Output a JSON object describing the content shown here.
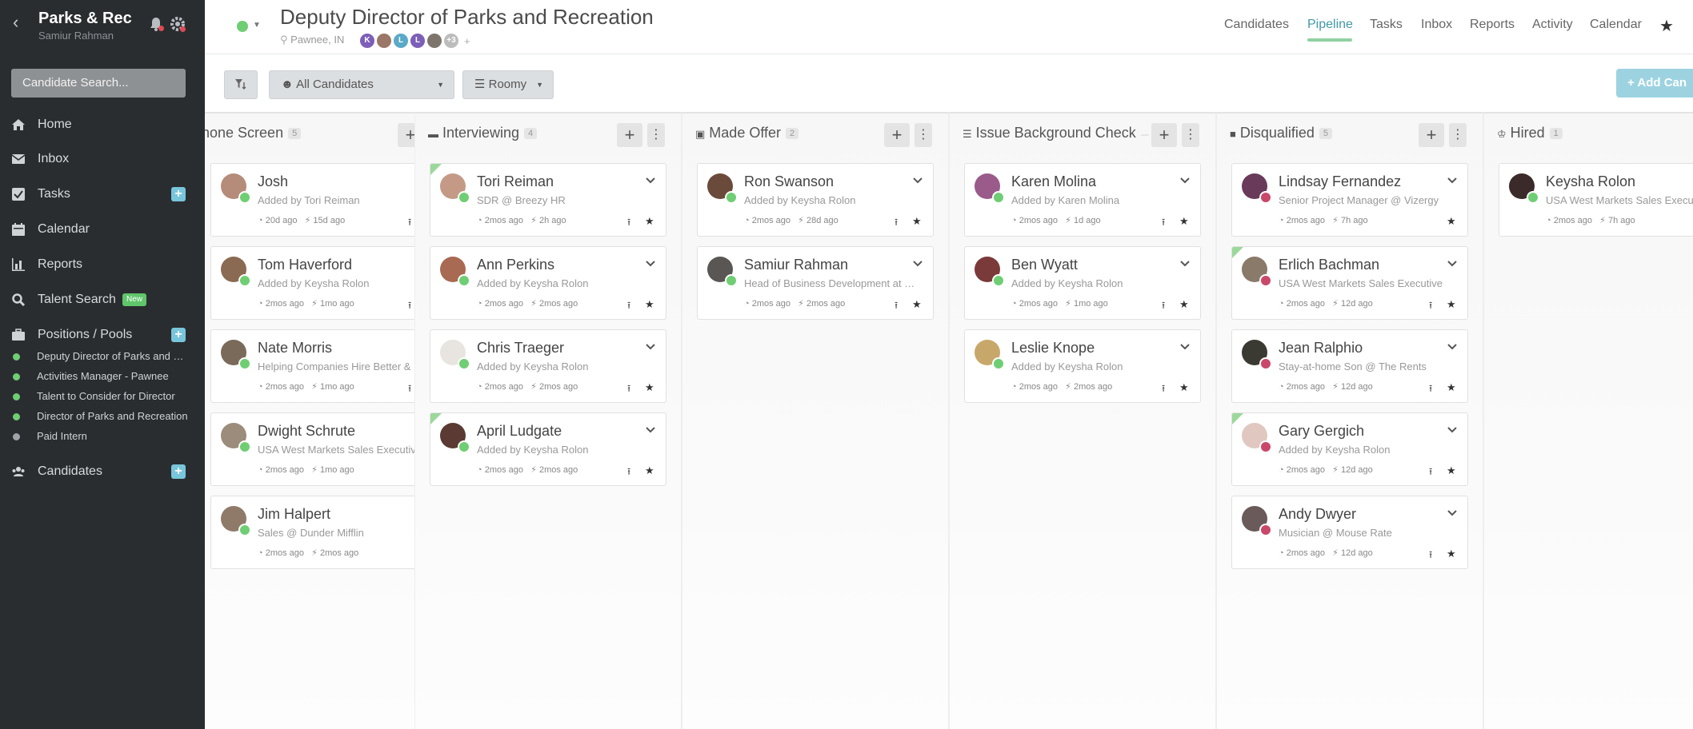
{
  "app": {
    "title": "Parks & Rec",
    "user": "Samiur Rahman",
    "search_placeholder": "Candidate Search..."
  },
  "nav": {
    "home": "Home",
    "inbox": "Inbox",
    "tasks": "Tasks",
    "calendar": "Calendar",
    "reports": "Reports",
    "talent": "Talent Search",
    "talent_badge": "New",
    "positions": "Positions / Pools",
    "candidates": "Candidates"
  },
  "positions": [
    {
      "label": "Deputy Director of Parks and Recreation",
      "color": "#6fce74"
    },
    {
      "label": "Activities Manager - Pawnee",
      "color": "#6fce74"
    },
    {
      "label": "Talent to Consider for Director",
      "color": "#6fce74"
    },
    {
      "label": "Director of Parks and Recreation",
      "color": "#6fce74"
    },
    {
      "label": "Paid Intern",
      "color": "#a0a4a8"
    }
  ],
  "header": {
    "title": "Deputy Director of Parks and Recreation",
    "location": "Pawnee, IN",
    "team": [
      {
        "initial": "K",
        "color": "#7c5fb8"
      },
      {
        "initial": "",
        "color": "#9a7766"
      },
      {
        "initial": "L",
        "color": "#5aa9c9"
      },
      {
        "initial": "L",
        "color": "#7c5fb8"
      },
      {
        "initial": "",
        "color": "#7d746c"
      },
      {
        "initial": "+3",
        "color": "#bcbcbc"
      }
    ],
    "more": "+"
  },
  "tabs": [
    "Candidates",
    "Pipeline",
    "Tasks",
    "Inbox",
    "Reports",
    "Activity",
    "Calendar"
  ],
  "active_tab": "Pipeline",
  "toolbar": {
    "candidates_filter": "All Candidates",
    "view": "Roomy",
    "add_button": "+ Add Can"
  },
  "columns": [
    {
      "title": "Phone Screen",
      "count": "5",
      "cards": [
        {
          "name": "Josh",
          "sub": "Added by Tori Reiman",
          "m1": "20d ago",
          "m2": "15d ago",
          "stage": "#6fce74",
          "flag": false,
          "share": true,
          "avatar": "#b58c7a"
        },
        {
          "name": "Tom Haverford",
          "sub": "Added by Keysha Rolon",
          "m1": "2mos ago",
          "m2": "1mo ago",
          "stage": "#6fce74",
          "flag": false,
          "share": true,
          "avatar": "#8a6a52"
        },
        {
          "name": "Nate Morris",
          "sub": "Helping Companies Hire Better & Faster",
          "m1": "2mos ago",
          "m2": "1mo ago",
          "stage": "#6fce74",
          "flag": false,
          "share": true,
          "avatar": "#7a6a5a"
        },
        {
          "name": "Dwight Schrute",
          "sub": "USA West Markets Sales Executive",
          "m1": "2mos ago",
          "m2": "1mo ago",
          "stage": "#6fce74",
          "flag": false,
          "share": false,
          "avatar": "#9c8c7c"
        },
        {
          "name": "Jim Halpert",
          "sub": "Sales @ Dunder Mifflin",
          "m1": "2mos ago",
          "m2": "2mos ago",
          "stage": "#6fce74",
          "flag": false,
          "share": false,
          "avatar": "#8f7a6a"
        }
      ]
    },
    {
      "title": "Interviewing",
      "count": "4",
      "cards": [
        {
          "name": "Tori Reiman",
          "sub": "SDR @ Breezy HR",
          "m1": "2mos ago",
          "m2": "2h ago",
          "stage": "#6fce74",
          "flag": true,
          "share": true,
          "avatar": "#c49a86"
        },
        {
          "name": "Ann Perkins",
          "sub": "Added by Keysha Rolon",
          "m1": "2mos ago",
          "m2": "2mos ago",
          "stage": "#6fce74",
          "flag": false,
          "share": true,
          "avatar": "#a86a52"
        },
        {
          "name": "Chris Traeger",
          "sub": "Added by Keysha Rolon",
          "m1": "2mos ago",
          "m2": "2mos ago",
          "stage": "#6fce74",
          "flag": false,
          "share": true,
          "avatar": "#e8e4e0"
        },
        {
          "name": "April Ludgate",
          "sub": "Added by Keysha Rolon",
          "m1": "2mos ago",
          "m2": "2mos ago",
          "stage": "#6fce74",
          "flag": true,
          "share": true,
          "avatar": "#5a3a32"
        }
      ]
    },
    {
      "title": "Made Offer",
      "count": "2",
      "cards": [
        {
          "name": "Ron Swanson",
          "sub": "Added by Keysha Rolon",
          "m1": "2mos ago",
          "m2": "28d ago",
          "stage": "#6fce74",
          "flag": false,
          "share": true,
          "avatar": "#6a4a3a"
        },
        {
          "name": "Samiur Rahman",
          "sub": "Head of Business Development at Breezy HR",
          "m1": "2mos ago",
          "m2": "2mos ago",
          "stage": "#6fce74",
          "flag": false,
          "share": true,
          "avatar": "#5a5654"
        }
      ]
    },
    {
      "title": "Issue Background Check",
      "count": "",
      "cards": [
        {
          "name": "Karen Molina",
          "sub": "Added by Karen Molina",
          "m1": "2mos ago",
          "m2": "1d ago",
          "stage": "#6fce74",
          "flag": false,
          "share": true,
          "avatar": "#9a5a8a"
        },
        {
          "name": "Ben Wyatt",
          "sub": "Added by Keysha Rolon",
          "m1": "2mos ago",
          "m2": "1mo ago",
          "stage": "#6fce74",
          "flag": false,
          "share": true,
          "avatar": "#7a3a3a"
        },
        {
          "name": "Leslie Knope",
          "sub": "Added by Keysha Rolon",
          "m1": "2mos ago",
          "m2": "2mos ago",
          "stage": "#6fce74",
          "flag": false,
          "share": true,
          "avatar": "#c8a86a"
        }
      ]
    },
    {
      "title": "Disqualified",
      "count": "5",
      "cards": [
        {
          "name": "Lindsay Fernandez",
          "sub": "Senior Project Manager @ Vizergy",
          "m1": "2mos ago",
          "m2": "7h ago",
          "stage": "#c9486a",
          "flag": false,
          "share": false,
          "avatar": "#6a3a5a"
        },
        {
          "name": "Erlich Bachman",
          "sub": "USA West Markets Sales Executive",
          "m1": "2mos ago",
          "m2": "12d ago",
          "stage": "#c9486a",
          "flag": true,
          "share": true,
          "avatar": "#8a7a6a"
        },
        {
          "name": "Jean Ralphio",
          "sub": "Stay-at-home Son @ The Rents",
          "m1": "2mos ago",
          "m2": "12d ago",
          "stage": "#c9486a",
          "flag": false,
          "share": true,
          "avatar": "#3a3a32"
        },
        {
          "name": "Gary Gergich",
          "sub": "Added by Keysha Rolon",
          "m1": "2mos ago",
          "m2": "12d ago",
          "stage": "#c9486a",
          "flag": true,
          "share": true,
          "avatar": "#e0c8c0"
        },
        {
          "name": "Andy Dwyer",
          "sub": "Musician @ Mouse Rate",
          "m1": "2mos ago",
          "m2": "12d ago",
          "stage": "#c9486a",
          "flag": false,
          "share": true,
          "avatar": "#6a5a5a"
        }
      ]
    },
    {
      "title": "Hired",
      "count": "1",
      "cards": [
        {
          "name": "Keysha Rolon",
          "sub": "USA West Markets Sales Executive",
          "m1": "2mos ago",
          "m2": "7h ago",
          "stage": "#6fce74",
          "flag": false,
          "share": false,
          "avatar": "#3a2a2a"
        }
      ]
    }
  ]
}
